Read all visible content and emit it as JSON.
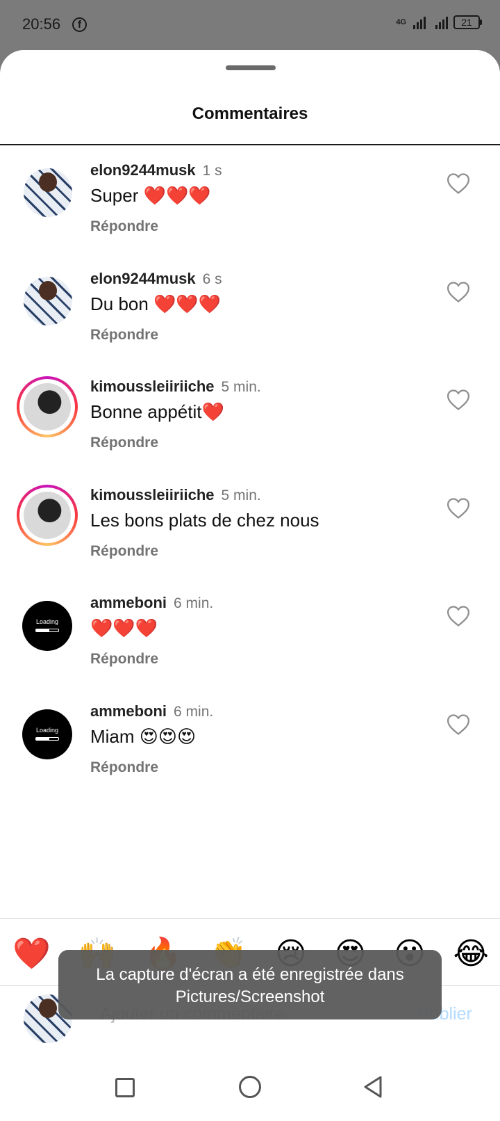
{
  "status_bar": {
    "time": "20:56",
    "network_label": "4G",
    "battery": "21"
  },
  "sheet": {
    "title": "Commentaires"
  },
  "comments": [
    {
      "user": "elon9244musk",
      "time": "1 s",
      "text": "Super ❤️❤️❤️",
      "reply": "Répondre",
      "avatar": "photo"
    },
    {
      "user": "elon9244musk",
      "time": "6 s",
      "text": "Du bon ❤️❤️❤️",
      "reply": "Répondre",
      "avatar": "photo"
    },
    {
      "user": "kimoussleiiriiche",
      "time": "5 min.",
      "text": "Bonne appétit❤️",
      "reply": "Répondre",
      "avatar": "story-ring"
    },
    {
      "user": "kimoussleiiriiche",
      "time": "5 min.",
      "text": "Les bons plats de chez nous",
      "reply": "Répondre",
      "avatar": "story-ring"
    },
    {
      "user": "ammeboni",
      "time": "6 min.",
      "text": "❤️❤️❤️",
      "reply": "Répondre",
      "avatar": "loading"
    },
    {
      "user": "ammeboni",
      "time": "6 min.",
      "text": "Miam 😍😍😍",
      "reply": "Répondre",
      "avatar": "loading"
    }
  ],
  "avatar_loading_text": "Loading",
  "emoji_bar": [
    "❤️",
    "🙌",
    "🔥",
    "👏",
    "😢",
    "😍",
    "😮",
    "😂"
  ],
  "compose": {
    "placeholder": "Ajouter un commentaire...",
    "publish_label": "Publier"
  },
  "toast": {
    "line1": "La capture d'écran a été enregistrée dans",
    "line2": "Pictures/Screenshot"
  },
  "colors": {
    "accent_publish": "#b3dbff",
    "story_ring_start": "#c913b9",
    "story_ring_end": "#fec564",
    "heart_outline": "#8e8e8e"
  }
}
